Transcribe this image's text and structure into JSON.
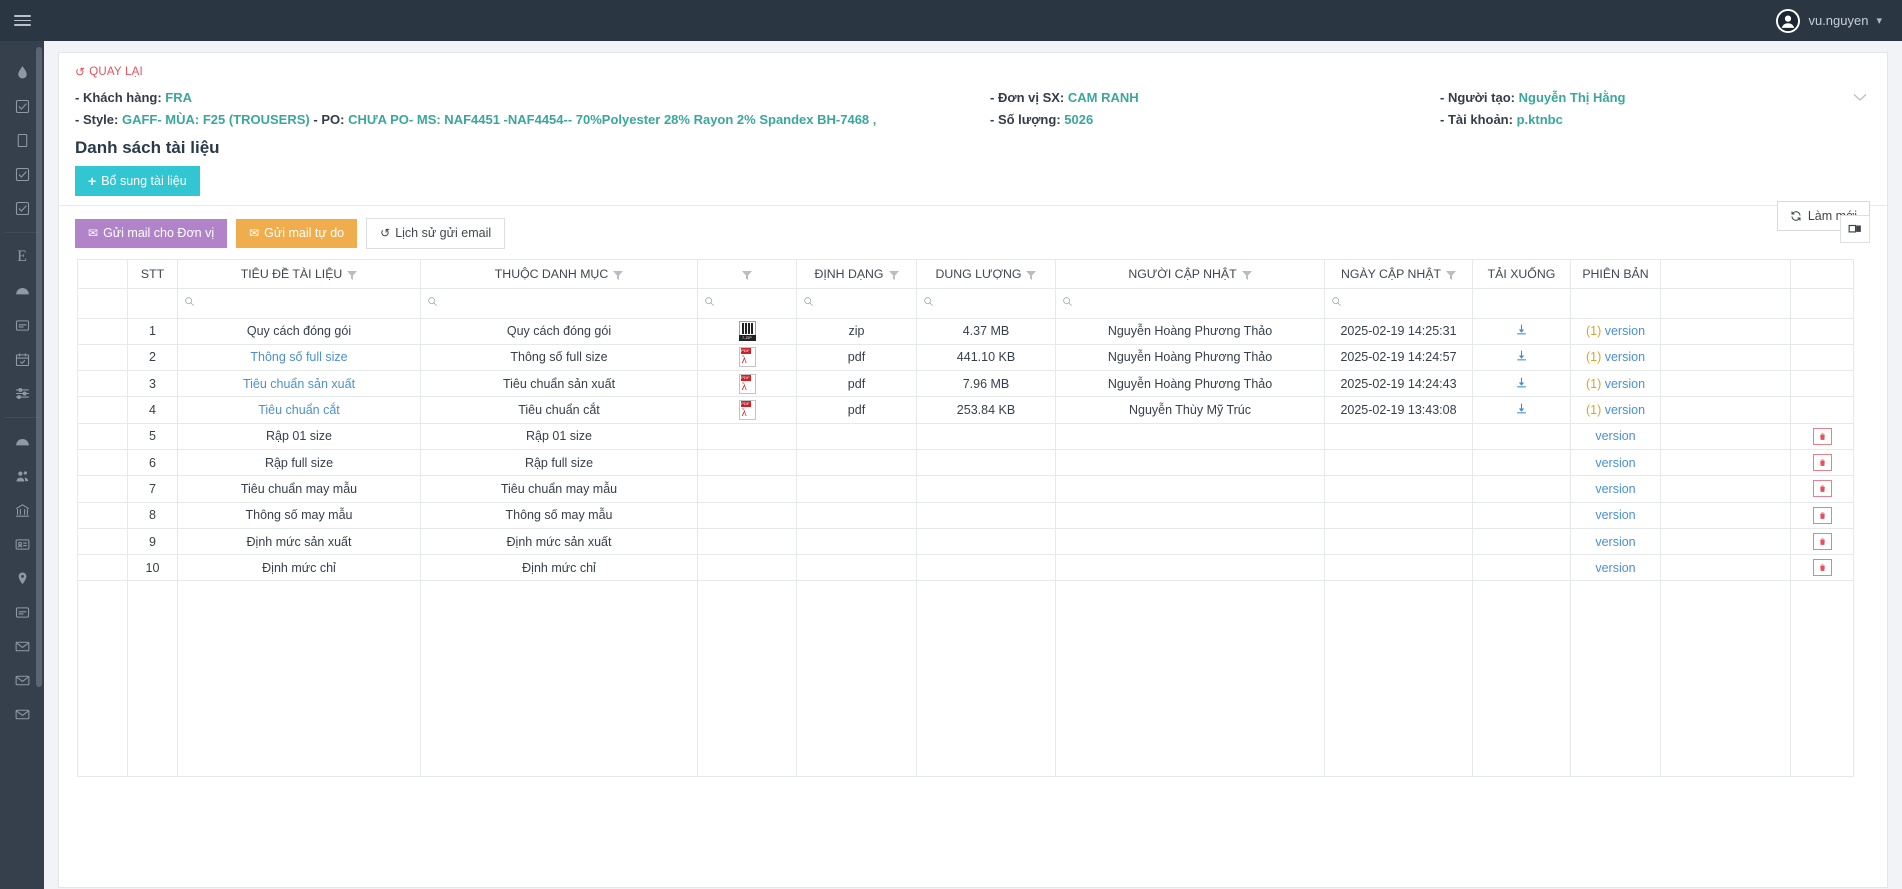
{
  "topbar": {
    "user_name": "vu.nguyen",
    "avatar_icon": "user-circle-icon",
    "caret_icon": "chevron-down-icon"
  },
  "sidebar": {
    "menu_icon": "hamburger-icon",
    "items": [
      {
        "icon": "droplet-icon",
        "name": "droplet"
      },
      {
        "icon": "checkbox-checked-icon",
        "name": "task-1"
      },
      {
        "icon": "square-icon",
        "name": "square"
      },
      {
        "icon": "checkbox-checked-icon",
        "name": "task-2"
      },
      {
        "icon": "checkbox-checked-icon",
        "name": "task-3"
      },
      {
        "icon": "letter-e-icon",
        "name": "e-module"
      },
      {
        "icon": "gauge-icon",
        "name": "dashboard"
      },
      {
        "icon": "list-card-icon",
        "name": "list-card"
      },
      {
        "icon": "calendar-check-icon",
        "name": "calendar"
      },
      {
        "icon": "sliders-icon",
        "name": "settings-sliders"
      },
      {
        "icon": "gauge-icon",
        "name": "dashboard-2"
      },
      {
        "icon": "users-icon",
        "name": "users"
      },
      {
        "icon": "bank-icon",
        "name": "bank"
      },
      {
        "icon": "id-card-icon",
        "name": "id-card"
      },
      {
        "icon": "map-pin-icon",
        "name": "location"
      },
      {
        "icon": "list-card-icon",
        "name": "list-card-2"
      },
      {
        "icon": "envelope-icon",
        "name": "mail-1"
      },
      {
        "icon": "envelope-icon",
        "name": "mail-2"
      },
      {
        "icon": "envelope-icon",
        "name": "mail-3"
      }
    ]
  },
  "header": {
    "back_label": "QUAY LẠI",
    "back_icon": "undo-icon",
    "collapse_icon": "chevron-down-icon",
    "fields": [
      {
        "label": "- Khách hàng:",
        "value": "FRA"
      },
      {
        "label": "- Đơn vị SX:",
        "value": "CAM RANH"
      },
      {
        "label": "- Người tạo:",
        "value": "Nguyễn Thị Hằng"
      },
      {
        "label": "- Style:",
        "value": "GAFF- MÙA: F25 (TROUSERS)"
      },
      {
        "label": "- PO:",
        "value": "CHƯA PO- MS: NAF4451 -NAF4454-- 70%Polyester 28% Rayon 2% Spandex BH-7468 ,"
      },
      {
        "label": "- Số lượng:",
        "value": "5026"
      },
      {
        "label": "- Tài khoản:",
        "value": "p.ktnbc"
      }
    ]
  },
  "main": {
    "title": "Danh sách tài liệu",
    "add_button": "Bổ sung tài liệu",
    "add_icon": "plus-icon",
    "refresh_button": "Làm mới",
    "refresh_icon": "refresh-icon",
    "toolbar": {
      "mail_unit_label": "Gửi mail cho Đơn vị",
      "mail_free_label": "Gửi mail tự do",
      "history_label": "Lịch sử gửi email",
      "mail_icon": "envelope-icon",
      "history_icon": "undo-icon",
      "export_icon": "copy-export-icon"
    }
  },
  "table": {
    "search_icon": "search-icon",
    "filter_icon": "funnel-icon",
    "download_icon": "download-icon",
    "delete_icon": "trash-icon",
    "columns": [
      {
        "label": "",
        "filter": false,
        "search": false
      },
      {
        "label": "STT",
        "filter": false,
        "search": false
      },
      {
        "label": "TIÊU ĐỀ TÀI LIỆU",
        "filter": true,
        "search": true
      },
      {
        "label": "THUỘC DANH MỤC",
        "filter": true,
        "search": true
      },
      {
        "label": "",
        "filter": true,
        "search": true
      },
      {
        "label": "ĐỊNH DẠNG",
        "filter": true,
        "search": true
      },
      {
        "label": "DUNG LƯỢNG",
        "filter": true,
        "search": true
      },
      {
        "label": "NGƯỜI CẬP NHẬT",
        "filter": true,
        "search": true
      },
      {
        "label": "NGÀY CẬP NHẬT",
        "filter": true,
        "search": true
      },
      {
        "label": "TẢI XUỐNG",
        "filter": false,
        "search": false
      },
      {
        "label": "PHIÊN BẢN",
        "filter": false,
        "search": false
      },
      {
        "label": "",
        "filter": false,
        "search": false
      },
      {
        "label": "",
        "filter": false,
        "search": false
      }
    ],
    "rows": [
      {
        "stt": "1",
        "title": "Quy cách đóng gói",
        "is_link": false,
        "category": "Quy cách đóng gói",
        "filetype": "zip-icon",
        "format": "zip",
        "size": "4.37 MB",
        "updater": "Nguyễn Hoàng Phương Thảo",
        "updated": "2025-02-19 14:25:31",
        "download": true,
        "version_count": "(1)",
        "version_label": "version",
        "deletable": false
      },
      {
        "stt": "2",
        "title": "Thông số full size",
        "is_link": true,
        "category": "Thông số full size",
        "filetype": "pdf-icon",
        "format": "pdf",
        "size": "441.10 KB",
        "updater": "Nguyễn Hoàng Phương Thảo",
        "updated": "2025-02-19 14:24:57",
        "download": true,
        "version_count": "(1)",
        "version_label": "version",
        "deletable": false
      },
      {
        "stt": "3",
        "title": "Tiêu chuẩn sản xuất",
        "is_link": true,
        "category": "Tiêu chuẩn sản xuất",
        "filetype": "pdf-icon",
        "format": "pdf",
        "size": "7.96 MB",
        "updater": "Nguyễn Hoàng Phương Thảo",
        "updated": "2025-02-19 14:24:43",
        "download": true,
        "version_count": "(1)",
        "version_label": "version",
        "deletable": false
      },
      {
        "stt": "4",
        "title": "Tiêu chuẩn cắt",
        "is_link": true,
        "category": "Tiêu chuẩn cắt",
        "filetype": "pdf-icon",
        "format": "pdf",
        "size": "253.84 KB",
        "updater": "Nguyễn Thùy Mỹ Trúc",
        "updated": "2025-02-19 13:43:08",
        "download": true,
        "version_count": "(1)",
        "version_label": "version",
        "deletable": false
      },
      {
        "stt": "5",
        "title": "Rập 01 size",
        "is_link": false,
        "category": "Rập 01 size",
        "filetype": "",
        "format": "",
        "size": "",
        "updater": "",
        "updated": "",
        "download": false,
        "version_count": "",
        "version_label": "version",
        "deletable": true
      },
      {
        "stt": "6",
        "title": "Rập full size",
        "is_link": false,
        "category": "Rập full size",
        "filetype": "",
        "format": "",
        "size": "",
        "updater": "",
        "updated": "",
        "download": false,
        "version_count": "",
        "version_label": "version",
        "deletable": true
      },
      {
        "stt": "7",
        "title": "Tiêu chuẩn may mẫu",
        "is_link": false,
        "category": "Tiêu chuẩn may mẫu",
        "filetype": "",
        "format": "",
        "size": "",
        "updater": "",
        "updated": "",
        "download": false,
        "version_count": "",
        "version_label": "version",
        "deletable": true
      },
      {
        "stt": "8",
        "title": "Thông số may mẫu",
        "is_link": false,
        "category": "Thông số may mẫu",
        "filetype": "",
        "format": "",
        "size": "",
        "updater": "",
        "updated": "",
        "download": false,
        "version_count": "",
        "version_label": "version",
        "deletable": true
      },
      {
        "stt": "9",
        "title": "Định mức sản xuất",
        "is_link": false,
        "category": "Định mức sản xuất",
        "filetype": "",
        "format": "",
        "size": "",
        "updater": "",
        "updated": "",
        "download": false,
        "version_count": "",
        "version_label": "version",
        "deletable": true
      },
      {
        "stt": "10",
        "title": "Định mức chỉ",
        "is_link": false,
        "category": "Định mức chỉ",
        "filetype": "",
        "format": "",
        "size": "",
        "updater": "",
        "updated": "",
        "download": false,
        "version_count": "",
        "version_label": "version",
        "deletable": true
      }
    ]
  },
  "colors": {
    "topbar_bg": "#2b3643",
    "sidebar_bg": "#36404d",
    "accent_teal": "#3aa79b",
    "accent_cyan": "#32c5d2",
    "accent_purple": "#b183c9",
    "accent_orange": "#f0ad4e",
    "accent_red": "#e7505a",
    "link_blue": "#4b91d0",
    "version_count": "#d9a42b"
  }
}
